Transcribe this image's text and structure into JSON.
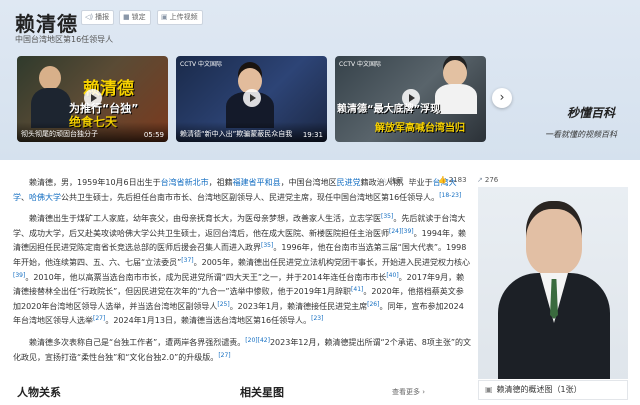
{
  "header": {
    "title": "赖清德",
    "subtitle": "中国台湾地区第16任领导人",
    "buttons": [
      {
        "label": "播报",
        "icon": "speaker-icon"
      },
      {
        "label": "锁定",
        "icon": "lock-icon"
      },
      {
        "label": "上传视频",
        "icon": "video-upload-icon"
      }
    ]
  },
  "videos": [
    {
      "caption": "彻头彻尾的顽固台独分子",
      "duration": "05:59",
      "overlay_main": "赖清德",
      "overlay_sub": "为推行“台独”",
      "overlay_sub2": "绝食七天"
    },
    {
      "caption": "赖清德“新中入出”欺骗蒙蔽民众自我",
      "duration": "19:31",
      "channel": "CCTV 中文国际"
    },
    {
      "caption": "",
      "duration": "",
      "overlay_main": "赖清德“最大底牌”浮现",
      "overlay_sub": "解放军高喊台湾当归",
      "channel": "CCTV 中文国际"
    }
  ],
  "brand": {
    "name": "秒懂百科",
    "slogan": "一看就懂的视频百科"
  },
  "stats": {
    "favorite_label": "收藏",
    "likes": "2183",
    "shares": "276"
  },
  "article": {
    "p1": {
      "t1": "赖清德，男，1959年10月6日出生于",
      "l1": "台湾省新北市",
      "t2": "，祖籍",
      "l2": "福建省平和县",
      "t3": "，中国台湾地区",
      "l3": "民进党",
      "t4": "籍政治人物，毕业于",
      "l4": "台湾大学",
      "t5": "、",
      "l5": "哈佛大学",
      "t6": "公共卫生硕士，先后担任台南市市长、台湾地区副领导人、民进党主席，现任中国台湾地区第16任领导人。",
      "s1": "[18-23]"
    },
    "p2": {
      "t1": "赖清德出生于煤矿工人家庭，幼年丧父，由母亲抚育长大，为医母亲梦想，改善家人生活，立志学医",
      "s1": "[35]",
      "t2": "。先后就读于台湾大学、成功大学，后又赴美攻读哈佛大学公共卫生硕士，返回台湾后，他在成大医院、新楼医院担任主治医师",
      "s2": "[24]",
      "s3": "[39]",
      "t3": "。1994年，赖清德因担任民进党陈定南省长竞选总部的医师后援会召集人而进入政界",
      "s4": "[35]",
      "t4": "。1996年，他在台南市当选第三届“国大代表”。1998年开始，他连续第四、五、六、七届“立法委员”",
      "s5": "[37]",
      "t5": "。2005年，赖清德出任民进党立法机构党团干事长，开始进入民进党权力核心",
      "s6": "[39]",
      "t6": "。2010年，他以高票当选台南市市长，成为民进党所谓“四大天王”之一，并于2014年连任台南市市长",
      "s7": "[40]",
      "t7": "。2017年9月，赖清德接替林全出任“行政院长”，但因民进党在次年的“九合一”选举中惨败，他于2019年1月辞职",
      "s8": "[41]",
      "t8": "。2020年，他搭档蔡英文参加2020年台湾地区领导人选举，并当选台湾地区副领导人",
      "s9": "[25]",
      "t9": "。2023年1月，赖清德接任民进党主席",
      "s10": "[26]",
      "t10": "。同年，宣布参加2024年台湾地区领导人选举",
      "s11": "[27]",
      "t11": "。2024年1月13日，赖清德当选台湾地区第16任领导人。",
      "s12": "[23]"
    },
    "p3": {
      "t1": "赖清德多次表称自己是“台独工作者”，遭两岸各界强烈谴责。",
      "s1": "[20]",
      "s2": "[42]",
      "t2": "2023年12月，赖清德提出所谓“2个承诺、8项主张”的文化政见，宣扬打造“柔性台独”和“文化台独2.0”的升级版。",
      "s3": "[27]"
    }
  },
  "photo": {
    "caption": "赖清德的概述图",
    "count": "（1张）"
  },
  "sections": {
    "people": "人物关系",
    "stars": "相关星图",
    "more": "查看更多"
  },
  "colors": {
    "link": "#136ec2",
    "header_bg": "#dfe8f3"
  }
}
